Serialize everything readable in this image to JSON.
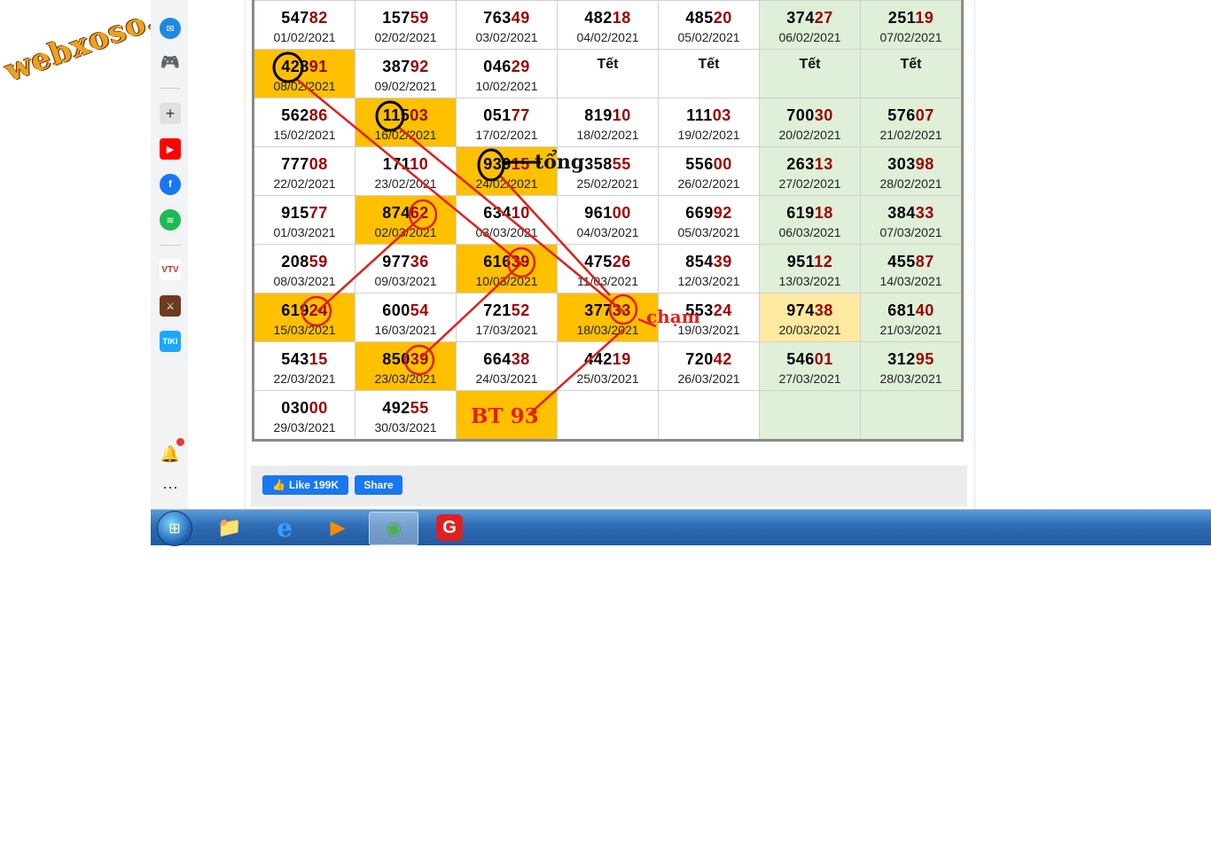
{
  "watermark": "webxoso.net",
  "table": {
    "rows": [
      [
        {
          "prefix": "547",
          "tail": "82",
          "date": "01/02/2021"
        },
        {
          "prefix": "157",
          "tail": "59",
          "date": "02/02/2021"
        },
        {
          "prefix": "763",
          "tail": "49",
          "date": "03/02/2021"
        },
        {
          "prefix": "482",
          "tail": "18",
          "date": "04/02/2021"
        },
        {
          "prefix": "485",
          "tail": "20",
          "date": "05/02/2021"
        },
        {
          "prefix": "374",
          "tail": "27",
          "date": "06/02/2021",
          "style": "wk"
        },
        {
          "prefix": "251",
          "tail": "19",
          "date": "07/02/2021",
          "style": "wk"
        }
      ],
      [
        {
          "prefix": "428",
          "tail": "91",
          "date": "08/02/2021",
          "style": "hl"
        },
        {
          "prefix": "387",
          "tail": "92",
          "date": "09/02/2021"
        },
        {
          "prefix": "046",
          "tail": "29",
          "date": "10/02/2021"
        },
        {
          "tet": "Tết"
        },
        {
          "tet": "Tết"
        },
        {
          "tet": "Tết",
          "style": "wk"
        },
        {
          "tet": "Tết",
          "style": "wk"
        }
      ],
      [
        {
          "prefix": "562",
          "tail": "86",
          "date": "15/02/2021"
        },
        {
          "prefix": "115",
          "tail": "03",
          "date": "16/02/2021",
          "style": "hl"
        },
        {
          "prefix": "051",
          "tail": "77",
          "date": "17/02/2021"
        },
        {
          "prefix": "819",
          "tail": "10",
          "date": "18/02/2021"
        },
        {
          "prefix": "111",
          "tail": "03",
          "date": "19/02/2021"
        },
        {
          "prefix": "700",
          "tail": "30",
          "date": "20/02/2021",
          "style": "wk"
        },
        {
          "prefix": "576",
          "tail": "07",
          "date": "21/02/2021",
          "style": "wk"
        }
      ],
      [
        {
          "prefix": "777",
          "tail": "08",
          "date": "22/02/2021"
        },
        {
          "prefix": "171",
          "tail": "10",
          "date": "23/02/2021"
        },
        {
          "prefix": "939",
          "tail": "15",
          "date": "24/02/2021",
          "style": "hl"
        },
        {
          "prefix": "358",
          "tail": "55",
          "date": "25/02/2021"
        },
        {
          "prefix": "556",
          "tail": "00",
          "date": "26/02/2021"
        },
        {
          "prefix": "263",
          "tail": "13",
          "date": "27/02/2021",
          "style": "wk"
        },
        {
          "prefix": "303",
          "tail": "98",
          "date": "28/02/2021",
          "style": "wk"
        }
      ],
      [
        {
          "prefix": "915",
          "tail": "77",
          "date": "01/03/2021"
        },
        {
          "prefix": "874",
          "tail": "62",
          "date": "02/03/2021",
          "style": "hl"
        },
        {
          "prefix": "634",
          "tail": "10",
          "date": "03/03/2021"
        },
        {
          "prefix": "961",
          "tail": "00",
          "date": "04/03/2021"
        },
        {
          "prefix": "669",
          "tail": "92",
          "date": "05/03/2021"
        },
        {
          "prefix": "619",
          "tail": "18",
          "date": "06/03/2021",
          "style": "wk"
        },
        {
          "prefix": "384",
          "tail": "33",
          "date": "07/03/2021",
          "style": "wk"
        }
      ],
      [
        {
          "prefix": "208",
          "tail": "59",
          "date": "08/03/2021"
        },
        {
          "prefix": "977",
          "tail": "36",
          "date": "09/03/2021"
        },
        {
          "prefix": "616",
          "tail": "39",
          "date": "10/03/2021",
          "style": "hl"
        },
        {
          "prefix": "475",
          "tail": "26",
          "date": "11/03/2021"
        },
        {
          "prefix": "854",
          "tail": "39",
          "date": "12/03/2021"
        },
        {
          "prefix": "951",
          "tail": "12",
          "date": "13/03/2021",
          "style": "wk"
        },
        {
          "prefix": "455",
          "tail": "87",
          "date": "14/03/2021",
          "style": "wk"
        }
      ],
      [
        {
          "prefix": "619",
          "tail": "24",
          "date": "15/03/2021",
          "style": "hl"
        },
        {
          "prefix": "600",
          "tail": "54",
          "date": "16/03/2021"
        },
        {
          "prefix": "721",
          "tail": "52",
          "date": "17/03/2021"
        },
        {
          "prefix": "377",
          "tail": "33",
          "date": "18/03/2021",
          "style": "hl"
        },
        {
          "prefix": "553",
          "tail": "24",
          "date": "19/03/2021"
        },
        {
          "prefix": "974",
          "tail": "38",
          "date": "20/03/2021",
          "style": "hy"
        },
        {
          "prefix": "681",
          "tail": "40",
          "date": "21/03/2021",
          "style": "wk"
        }
      ],
      [
        {
          "prefix": "543",
          "tail": "15",
          "date": "22/03/2021"
        },
        {
          "prefix": "850",
          "tail": "39",
          "date": "23/03/2021",
          "style": "hl"
        },
        {
          "prefix": "664",
          "tail": "38",
          "date": "24/03/2021"
        },
        {
          "prefix": "442",
          "tail": "19",
          "date": "25/03/2021"
        },
        {
          "prefix": "720",
          "tail": "42",
          "date": "26/03/2021"
        },
        {
          "prefix": "546",
          "tail": "01",
          "date": "27/03/2021",
          "style": "wk"
        },
        {
          "prefix": "312",
          "tail": "95",
          "date": "28/03/2021",
          "style": "wk"
        }
      ],
      [
        {
          "prefix": "030",
          "tail": "00",
          "date": "29/03/2021"
        },
        {
          "prefix": "492",
          "tail": "55",
          "date": "30/03/2021"
        },
        {
          "style": "hl"
        },
        {},
        {},
        {
          "style": "wk"
        },
        {
          "style": "wk"
        }
      ]
    ]
  },
  "annotations": {
    "tong": "tổng",
    "cham": "chạm",
    "bt": "BT 93"
  },
  "share": {
    "like_label": "Like 199K",
    "share_label": "Share"
  },
  "sidebar_icons": [
    "messenger-icon",
    "game-controller-icon",
    "add-icon",
    "youtube-icon",
    "facebook-icon",
    "spotify-icon",
    "vtv-go-icon",
    "game-avatar-icon",
    "tiki-icon",
    "bell-icon",
    "more-icon"
  ],
  "taskbar_icons": [
    "windows-start-icon",
    "file-explorer-icon",
    "internet-explorer-icon",
    "media-player-icon",
    "coc-coc-browser-icon",
    "garena-icon"
  ],
  "colors": {
    "highlight": "#ffc000",
    "weekend": "#dfefd8",
    "tail": "#9b0000",
    "annotation": "#e0201c"
  }
}
